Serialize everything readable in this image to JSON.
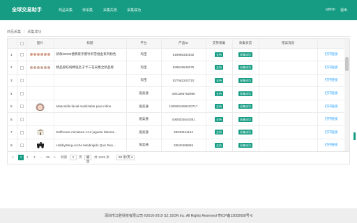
{
  "header": {
    "logo": "全球交易助手",
    "nav": [
      "商品采集",
      "待采集",
      "采集失败",
      "采集成功"
    ],
    "user": "admin",
    "logout": "退出"
  },
  "breadcrumb": [
    "商品采集",
    "采集成功"
  ],
  "table": {
    "columns": [
      "",
      "",
      "图片",
      "标题",
      "平台",
      "产品ID",
      "支持采集",
      "采集状态",
      "错误消息",
      ""
    ],
    "rows": [
      {
        "no": "1",
        "thumb": "strip-a",
        "title": "新款k6036便携家手腕针织雪组金系列粉色",
        "platform": "淘宝",
        "pid": "619665332532",
        "support": "支持",
        "status": "采集成功",
        "error": "",
        "action": "打开链接"
      },
      {
        "no": "2",
        "thumb": "strip-b",
        "title": "精品家纺纯棉链坠子卡三花采集全新品称",
        "platform": "淘宝",
        "pid": "629515545075",
        "support": "支持",
        "status": "采集成功",
        "error": "",
        "action": "打开链接"
      },
      {
        "no": "3",
        "thumb": "",
        "title": "",
        "platform": "淘宝",
        "pid": "527562243710",
        "support": "支持",
        "status": "采集成功",
        "error": "",
        "action": "打开链接"
      },
      {
        "no": "4",
        "thumb": "",
        "title": "",
        "platform": "速卖通",
        "pid": "4001285762896",
        "support": "支持",
        "status": "采集成功",
        "error": "",
        "action": "打开链接"
      },
      {
        "no": "5",
        "thumb": "face",
        "title": "Mascarilla facial reutilizable para niños",
        "platform": "速卖通",
        "pid": "1005001659220717",
        "support": "支持",
        "status": "采集成功",
        "error": "",
        "action": "打开链接"
      },
      {
        "no": "6",
        "thumb": "",
        "title": "",
        "platform": "速卖通",
        "pid": "4000003544391",
        "support": "支持",
        "status": "采集成功",
        "error": "",
        "action": "打开链接"
      },
      {
        "no": "7",
        "thumb": "doll",
        "title": "Dollhouse miniatura 1:12 juguete laborat...",
        "platform": "速卖通",
        "pid": "33040341144",
        "support": "支持",
        "status": "采集成功",
        "error": "",
        "action": "打开链接"
      },
      {
        "no": "8",
        "thumb": "car",
        "title": "HobbyWing-coche teledirigido Quic Run...",
        "platform": "速卖通",
        "pid": "33040496665",
        "support": "支持",
        "status": "采集成功",
        "error": "",
        "action": "打开链接"
      }
    ]
  },
  "pager": {
    "pages": [
      "1",
      "2",
      "3",
      "...",
      "39",
      ">"
    ],
    "current": "1",
    "goto_label": "到第",
    "goto_value": "1",
    "page_unit": "页",
    "go": "确定",
    "total": "共 1939 条",
    "per_page": "50 条/页"
  },
  "footer": "深圳市江胜科技有限公司 ©2010-2019 SZ JSON Inc. All Rights Reserved 粤ICP备13052658号-6",
  "colors": {
    "brand": "#169c83",
    "link": "#1e9fff"
  }
}
